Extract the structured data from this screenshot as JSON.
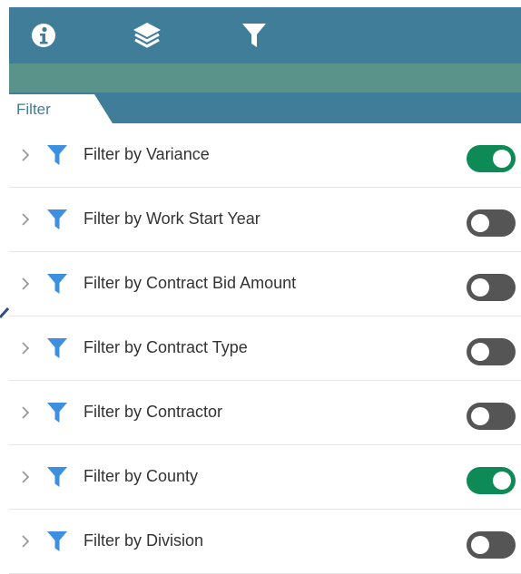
{
  "toolbar": {
    "buttons": [
      {
        "icon": "info-icon"
      },
      {
        "icon": "layers-icon"
      },
      {
        "icon": "filter-icon"
      }
    ]
  },
  "tabs": {
    "active_label": "Filter"
  },
  "colors": {
    "header": "#3f7d98",
    "subbar": "#5a9389",
    "funnel": "#3d8fe0",
    "toggle_on": "#0d8a55",
    "toggle_off": "#555555"
  },
  "filters": [
    {
      "label": "Filter by Variance",
      "enabled": true
    },
    {
      "label": "Filter by Work Start Year",
      "enabled": false
    },
    {
      "label": "Filter by Contract Bid Amount",
      "enabled": false
    },
    {
      "label": "Filter by Contract Type",
      "enabled": false
    },
    {
      "label": "Filter by Contractor",
      "enabled": false
    },
    {
      "label": "Filter by County",
      "enabled": true
    },
    {
      "label": "Filter by Division",
      "enabled": false
    }
  ]
}
